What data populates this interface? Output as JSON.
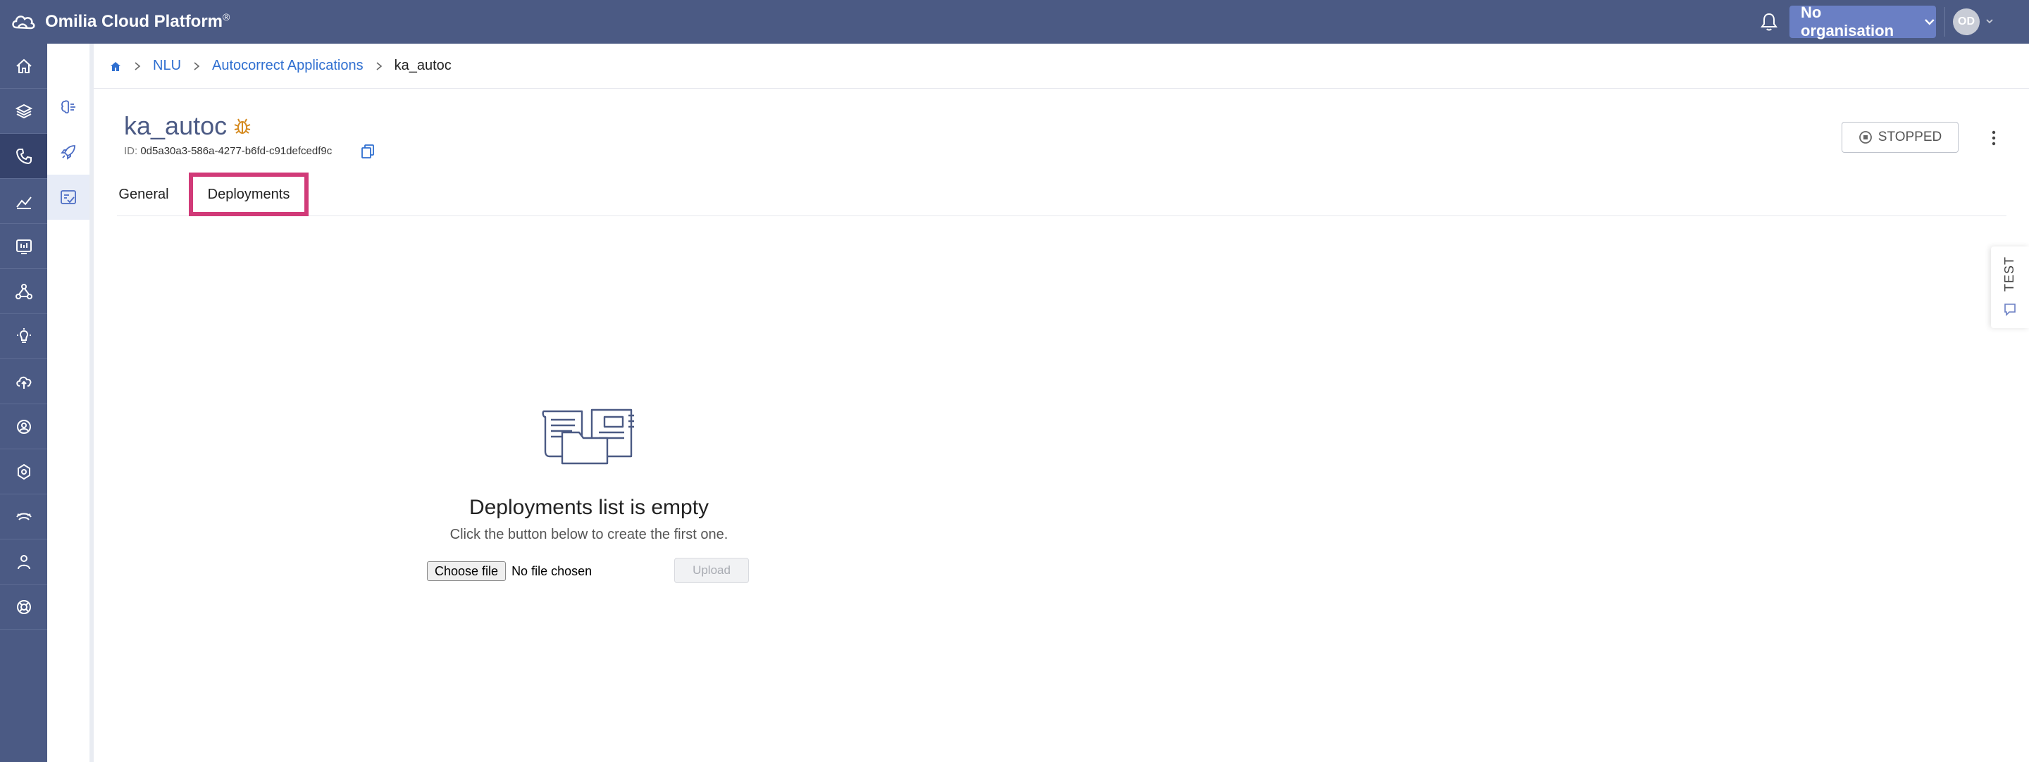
{
  "app": {
    "brand": "Omilia Cloud Platform",
    "brand_mark": "®",
    "org_label": "No organisation",
    "avatar_initials": "OD"
  },
  "rail": {
    "items": [
      "home-icon",
      "layers-icon",
      "phone-icon",
      "analytics-icon",
      "dashboard-icon",
      "network-icon",
      "bulb-icon",
      "cloud-icon",
      "users-settings-icon",
      "settings-icon",
      "monitor-icon",
      "user-icon",
      "support-icon"
    ],
    "active_index": 2
  },
  "subrail": {
    "items": [
      "nlu-brain-icon",
      "rocket-icon",
      "autocorrect-icon"
    ],
    "active_index": 2
  },
  "breadcrumb": {
    "items": [
      "NLU",
      "Autocorrect Applications"
    ],
    "current": "ka_autoc"
  },
  "app_detail": {
    "title": "ka_autoc",
    "id_label": "ID:",
    "id_value": "0d5a30a3-586a-4277-b6fd-c91defcedf9c",
    "status": "STOPPED"
  },
  "tabs": {
    "general": "General",
    "deployments": "Deployments",
    "active": "deployments"
  },
  "side_panel": {
    "label": "TEST"
  },
  "empty_state": {
    "title": "Deployments list is empty",
    "subtitle": "Click the button below to create the first one.",
    "choose_file": "Choose file",
    "no_file": "No file chosen",
    "upload": "Upload"
  },
  "colors": {
    "topbar": "#4b5a84",
    "accent": "#6a7fc4",
    "link": "#2f6fd0",
    "highlight": "#d13a78"
  }
}
